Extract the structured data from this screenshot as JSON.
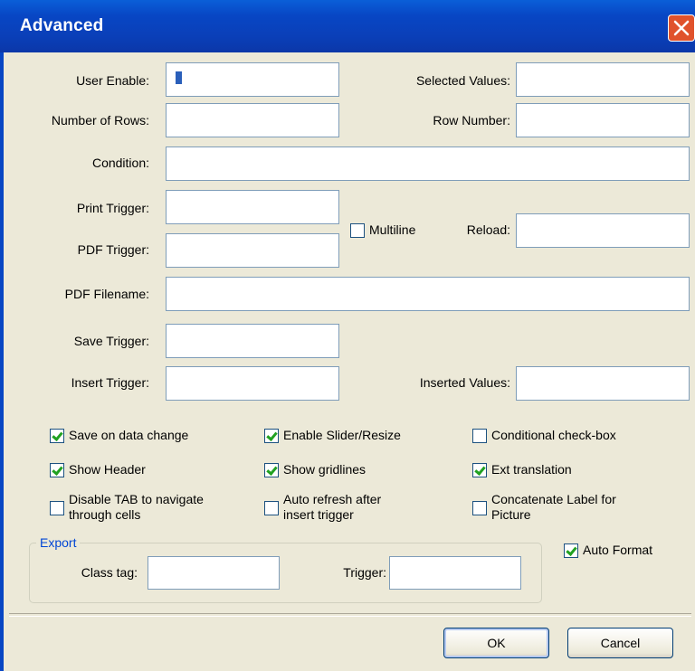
{
  "window": {
    "title": "Advanced"
  },
  "fields": {
    "user_enable": {
      "label": "User Enable:",
      "value": "1"
    },
    "selected_values": {
      "label": "Selected Values:",
      "value": ""
    },
    "number_of_rows": {
      "label": "Number of Rows:",
      "value": ""
    },
    "row_number": {
      "label": "Row Number:",
      "value": ""
    },
    "condition": {
      "label": "Condition:",
      "value": ""
    },
    "print_trigger": {
      "label": "Print Trigger:",
      "value": ""
    },
    "pdf_trigger": {
      "label": "PDF Trigger:",
      "value": ""
    },
    "reload": {
      "label": "Reload:",
      "value": ""
    },
    "pdf_filename": {
      "label": "PDF Filename:",
      "value": ""
    },
    "save_trigger": {
      "label": "Save Trigger:",
      "value": ""
    },
    "insert_trigger": {
      "label": "Insert Trigger:",
      "value": ""
    },
    "inserted_values": {
      "label": "Inserted Values:",
      "value": ""
    }
  },
  "checkboxes": {
    "multiline": {
      "label": "Multiline",
      "checked": false
    },
    "save_on_data_change": {
      "label": "Save on data change",
      "checked": true
    },
    "enable_slider_resize": {
      "label": "Enable Slider/Resize",
      "checked": true
    },
    "conditional_checkbox": {
      "label": "Conditional check-box",
      "checked": false
    },
    "show_header": {
      "label": "Show Header",
      "checked": true
    },
    "show_gridlines": {
      "label": "Show gridlines",
      "checked": true
    },
    "ext_translation": {
      "label": "Ext translation",
      "checked": true
    },
    "disable_tab_line1": {
      "label": "Disable TAB to navigate",
      "checked": false
    },
    "disable_tab_line2": {
      "label": "through cells"
    },
    "auto_refresh_line1": {
      "label": "Auto refresh after",
      "checked": false
    },
    "auto_refresh_line2": {
      "label": "insert trigger"
    },
    "concat_label_line1": {
      "label": "Concatenate Label for",
      "checked": false
    },
    "concat_label_line2": {
      "label": "Picture"
    },
    "auto_format": {
      "label": "Auto Format",
      "checked": true
    }
  },
  "export": {
    "legend": "Export",
    "class_tag": {
      "label": "Class tag:",
      "value": ""
    },
    "trigger": {
      "label": "Trigger:",
      "value": ""
    }
  },
  "buttons": {
    "ok": "OK",
    "cancel": "Cancel"
  },
  "colors": {
    "titlebar": "#0846c4",
    "dialog_bg": "#ece9d8",
    "close_button": "#e0522c",
    "check_mark": "#21a121",
    "legend_text": "#0046d5"
  }
}
